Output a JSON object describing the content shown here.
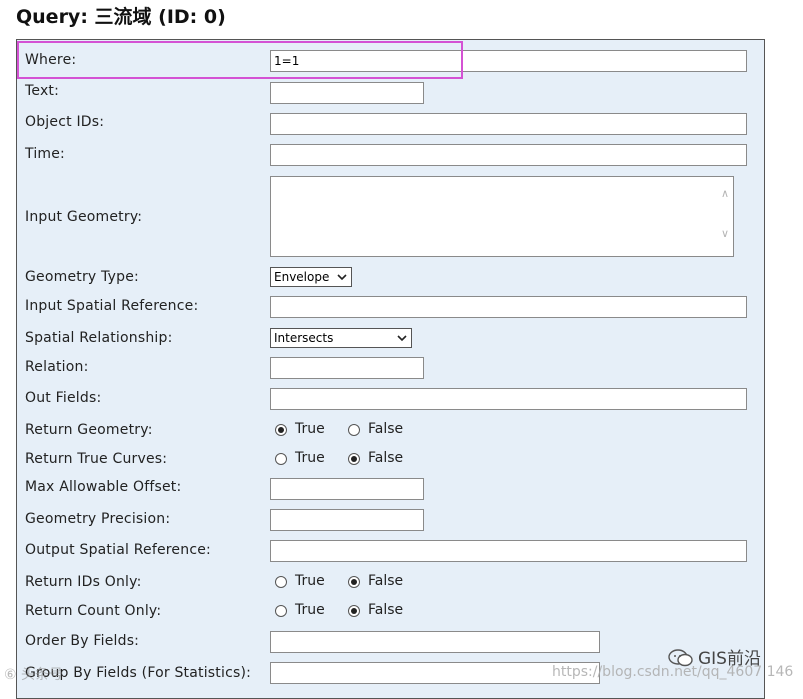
{
  "page": {
    "title": "Query: 三流域 (ID: 0)"
  },
  "form": {
    "where": {
      "label": "Where:",
      "value": "1=1"
    },
    "text": {
      "label": "Text:",
      "value": ""
    },
    "object_ids": {
      "label": "Object IDs:",
      "value": ""
    },
    "time": {
      "label": "Time:",
      "value": ""
    },
    "input_geometry": {
      "label": "Input Geometry:",
      "value": ""
    },
    "geometry_type": {
      "label": "Geometry Type:",
      "selected": "Envelope"
    },
    "input_spatial_reference": {
      "label": "Input Spatial Reference:",
      "value": ""
    },
    "spatial_relationship": {
      "label": "Spatial Relationship:",
      "selected": "Intersects"
    },
    "relation": {
      "label": "Relation:",
      "value": ""
    },
    "out_fields": {
      "label": "Out Fields:",
      "value": ""
    },
    "return_geometry": {
      "label": "Return Geometry:",
      "selected": "True"
    },
    "return_true_curves": {
      "label": "Return True Curves:",
      "selected": "False"
    },
    "max_allowable_offset": {
      "label": "Max Allowable Offset:",
      "value": ""
    },
    "geometry_precision": {
      "label": "Geometry Precision:",
      "value": ""
    },
    "output_spatial_reference": {
      "label": "Output Spatial Reference:",
      "value": ""
    },
    "return_ids_only": {
      "label": "Return IDs Only:",
      "selected": "False"
    },
    "return_count_only": {
      "label": "Return Count Only:",
      "selected": "False"
    },
    "order_by_fields": {
      "label": "Order By Fields:",
      "value": ""
    },
    "group_by_fields": {
      "label": "Group By Fields (For Statistics):",
      "value": ""
    },
    "radio_true_label": "True",
    "radio_false_label": "False"
  },
  "annotation": {
    "highlight_color": "#d452d4"
  },
  "watermarks": {
    "brand": "GIS前沿",
    "url": "https://blog.csdn.net/qq_4607 146",
    "left": "⑥ 头条号"
  },
  "colors": {
    "panel_bg": "#e6eff8",
    "panel_border": "#555555"
  }
}
